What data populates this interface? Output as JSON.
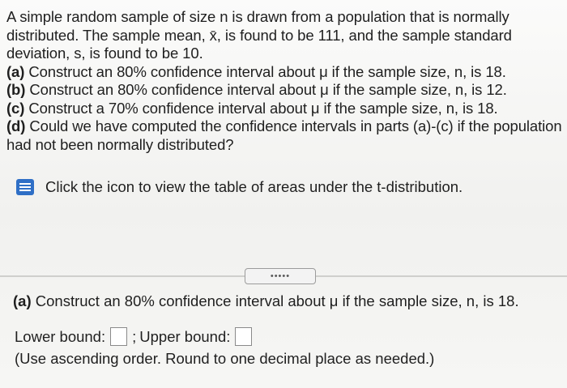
{
  "question": {
    "intro": "A simple random sample of size n is drawn from a population that is normally distributed. The sample mean, x̄, is found to be 111, and the sample standard deviation, s, is found to be 10.",
    "parts": [
      {
        "label": "(a)",
        "text": "Construct an 80% confidence interval about μ if the sample size, n, is 18."
      },
      {
        "label": "(b)",
        "text": "Construct an 80% confidence interval about μ if the sample size, n, is 12."
      },
      {
        "label": "(c)",
        "text": "Construct a 70% confidence interval about μ if the sample size, n, is 18."
      },
      {
        "label": "(d)",
        "text": "Could we have computed the confidence intervals in parts (a)-(c) if the population had not been normally distributed?"
      }
    ]
  },
  "hint": {
    "icon": "table-icon",
    "text": "Click the icon to view the table of areas under the t-distribution."
  },
  "toggle": {
    "label": "•••••"
  },
  "answer_section": {
    "part_label": "(a)",
    "part_text": "Construct an 80% confidence interval about μ if the sample size, n, is 18.",
    "lower_label": "Lower bound:",
    "upper_label": "Upper bound:",
    "separator": ";",
    "lower_value": "",
    "upper_value": "",
    "note": "(Use ascending order. Round to one decimal place as needed.)"
  }
}
